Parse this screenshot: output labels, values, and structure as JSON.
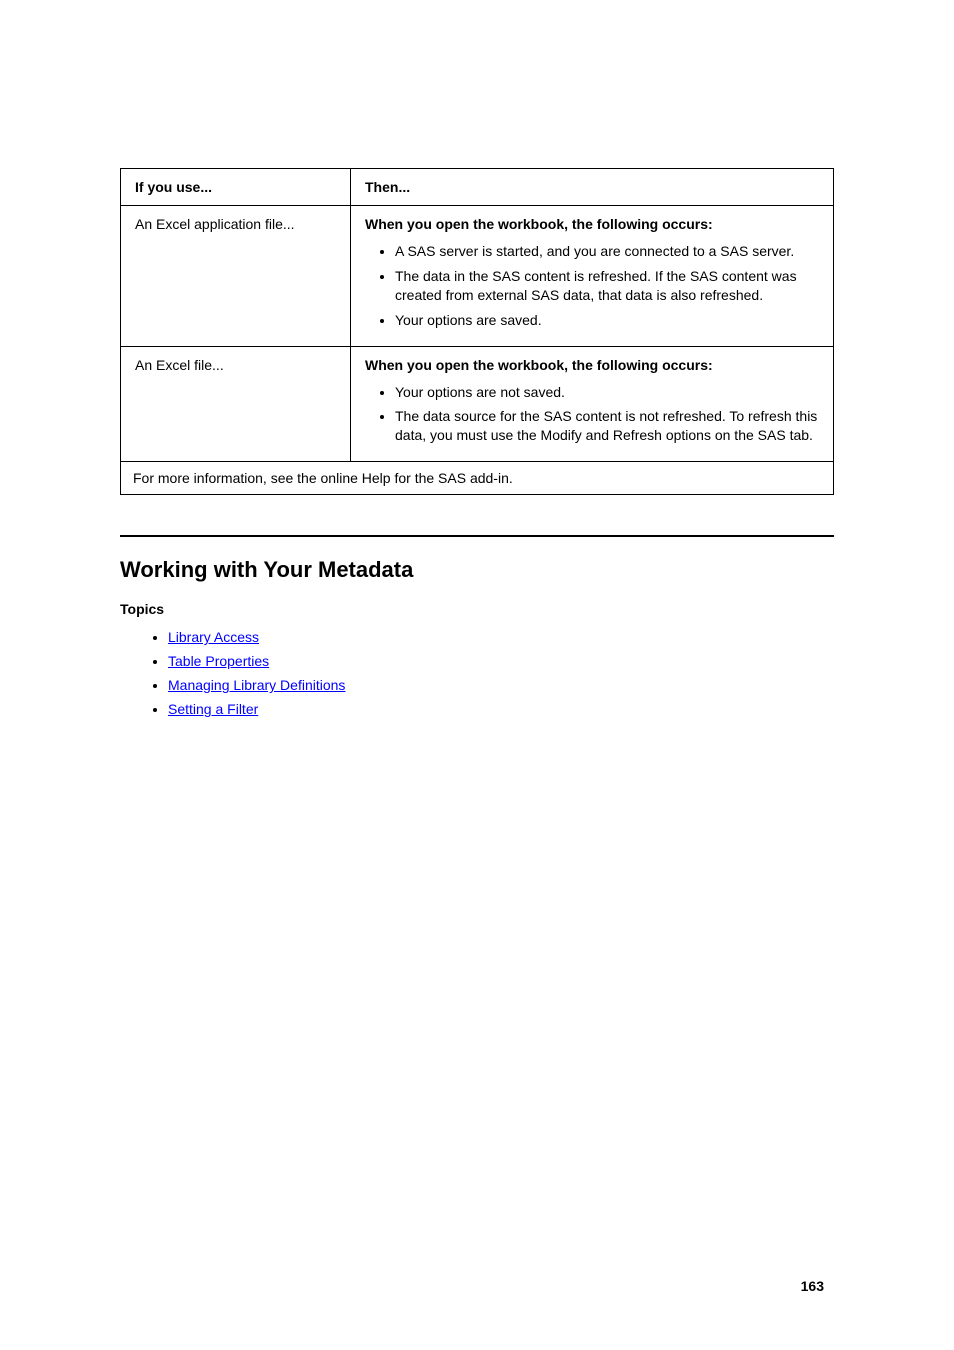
{
  "table": {
    "header": {
      "c1": "If you use...",
      "c2": "Then..."
    },
    "rows": [
      {
        "c1": "An Excel application file...",
        "c2_title": "When you open the workbook, the following occurs:",
        "c2_items": [
          "A SAS server is started, and you are connected to a SAS server.",
          "The data in the SAS content is refreshed. If the SAS content was created from external SAS data, that data is also refreshed.",
          "Your options are saved."
        ]
      },
      {
        "c1": "An Excel file...",
        "c2_title": "When you open the workbook, the following occurs:",
        "c2_items": [
          "Your options are not saved.",
          "The data source for the SAS content is not refreshed. To refresh this data, you must use the Modify and Refresh options on the SAS tab."
        ]
      }
    ],
    "last": "For more information, see the online Help for the SAS add-in."
  },
  "section_title": "Working with Your Metadata",
  "topics_title": "Topics",
  "topics": [
    {
      "label": "Library Access"
    },
    {
      "label": "Table Properties"
    },
    {
      "label": "Managing Library Definitions"
    },
    {
      "label": "Setting a Filter"
    }
  ],
  "page_number": "163"
}
